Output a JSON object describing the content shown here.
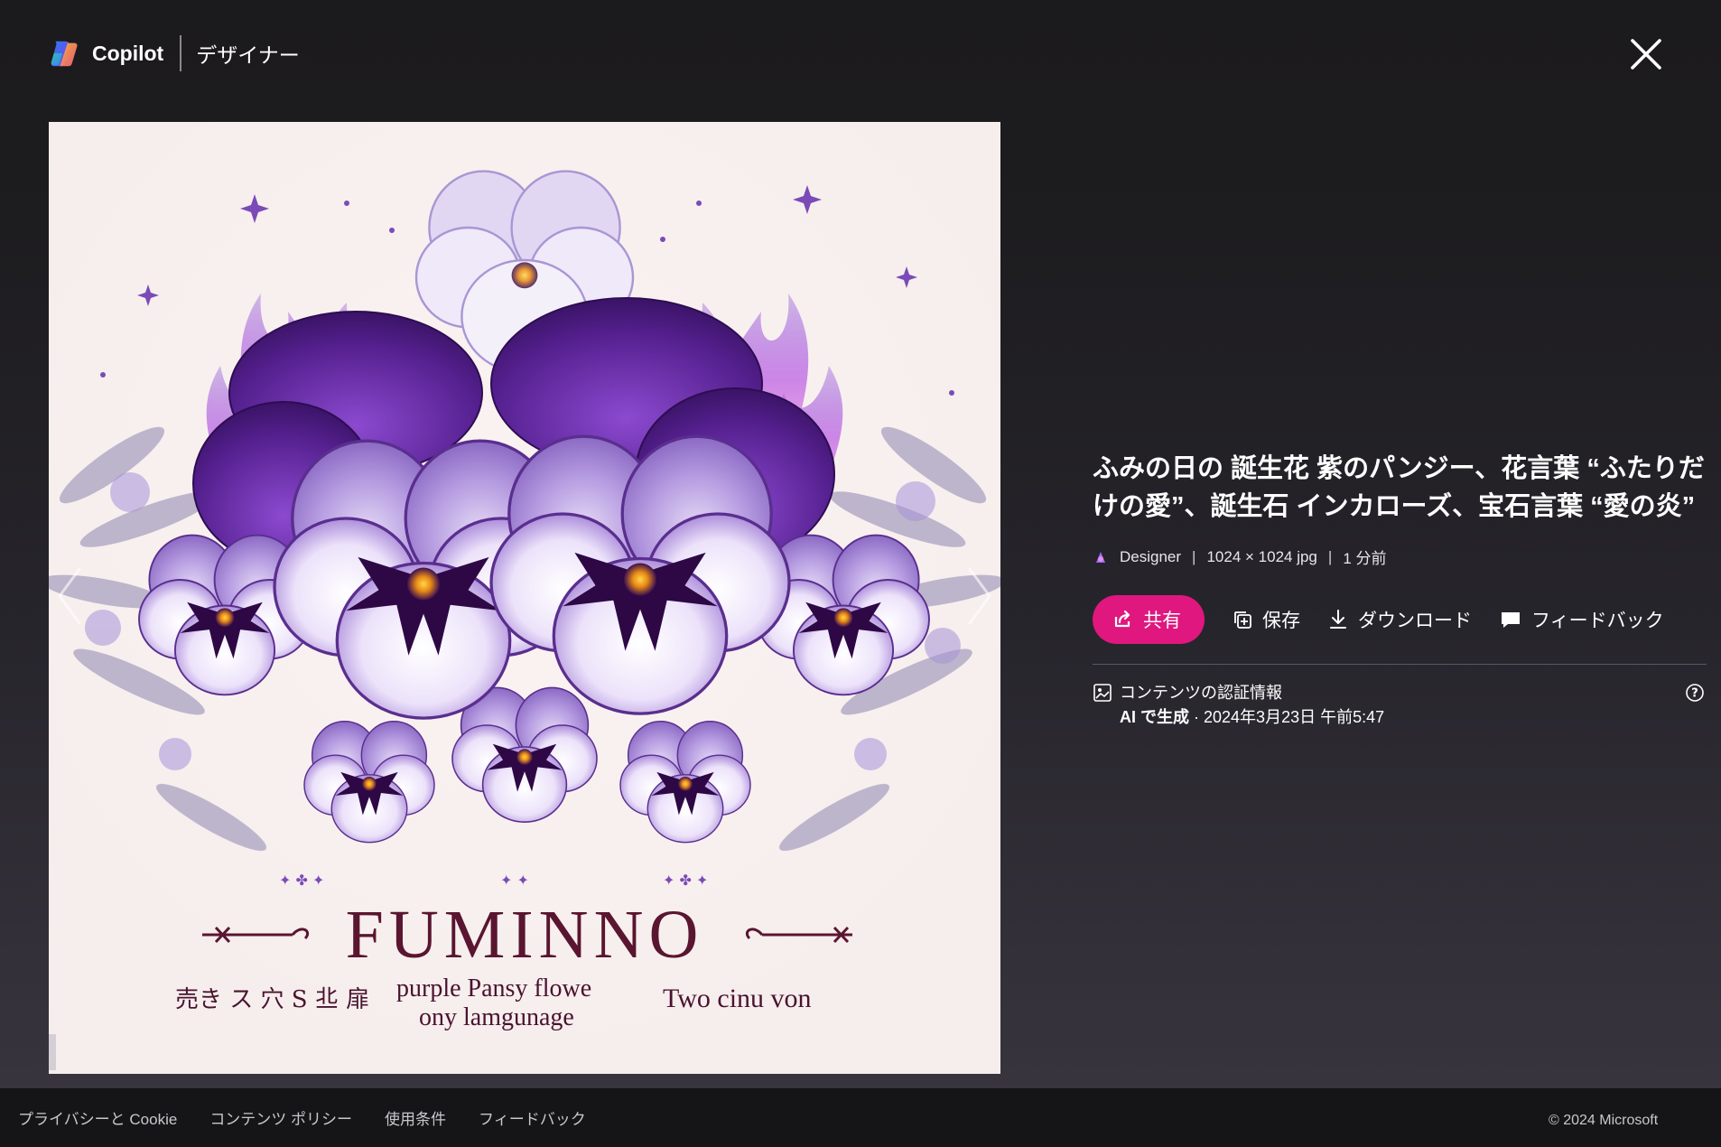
{
  "header": {
    "brand_name": "Copilot",
    "sub_name": "デザイナー",
    "close_icon": "close-icon"
  },
  "image": {
    "caption_title": "FUMINNO",
    "caption_left": "売き ス 穴 S 丠 扉",
    "caption_mid_line1": "purple  Pansy  flowe",
    "caption_mid_line2": "ony  lamgunage",
    "caption_right": "Two  cinu  von",
    "colors": {
      "background": "#f7f1ee",
      "deep_purple": "#4b1a7a",
      "violet": "#8e63c4",
      "lavender": "#c7b4ea",
      "flame": "#d77be8",
      "text": "#5a1530"
    }
  },
  "info": {
    "title": "ふみの日の 誕生花 紫のパンジー、花言葉 “ふたりだけの愛”、誕生石 インカローズ、宝石言葉 “愛の炎”",
    "meta_source": "Designer",
    "meta_size": "1024 × 1024 jpg",
    "meta_time": "1 分前",
    "meta_sep": "|",
    "share_label": "共有",
    "save_label": "保存",
    "download_label": "ダウンロード",
    "feedback_label": "フィードバック",
    "cred_title": "コンテンツの認証情報",
    "cred_ai": "AI で生成",
    "cred_date": " · 2024年3月23日 午前5:47",
    "accent_color": "#e0177f"
  },
  "footer": {
    "links": [
      "プライバシーと Cookie",
      "コンテンツ ポリシー",
      "使用条件",
      "フィードバック"
    ],
    "copyright": "© 2024 Microsoft"
  }
}
